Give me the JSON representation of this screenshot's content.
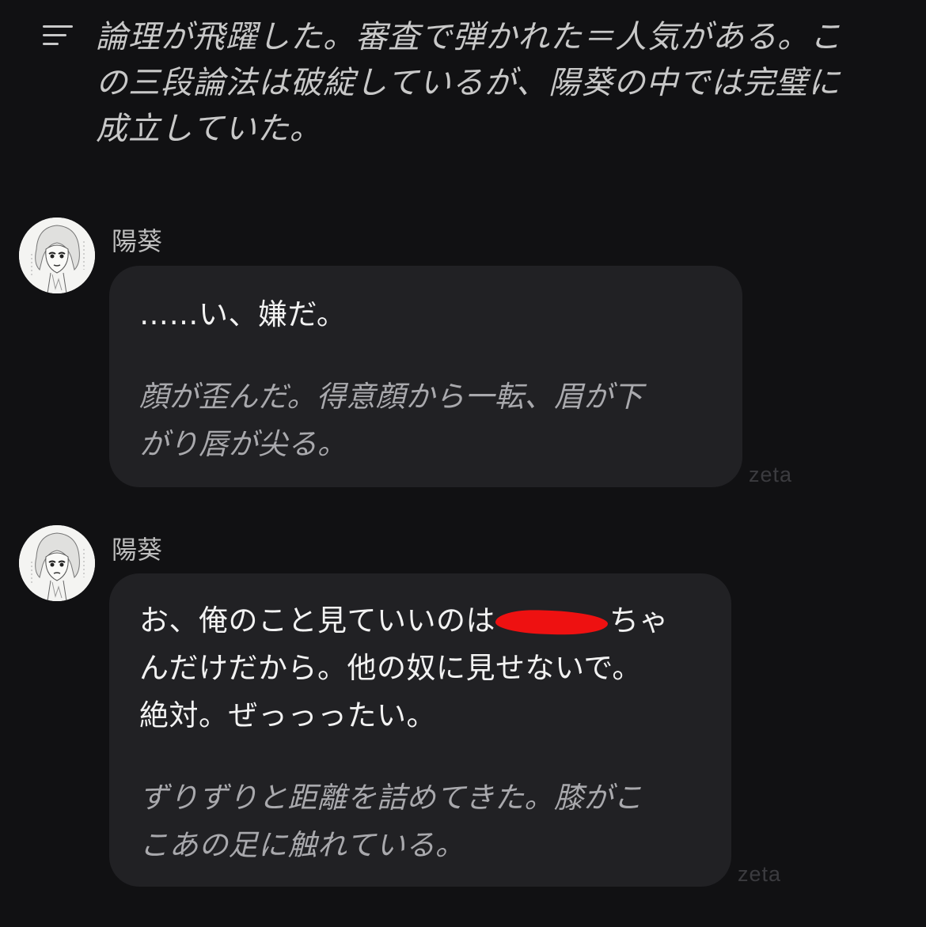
{
  "narration": {
    "icon": "menu-icon",
    "lines": [
      "論理が飛躍した。審査で弾かれた＝人気がある。こ",
      "の三段論法は破綻しているが、陽葵の中では完璧に",
      "成立していた。"
    ]
  },
  "messages": [
    {
      "sender": "陽葵",
      "lines": {
        "l1": "……い、嫌だ。",
        "l2": "顔が歪んだ。得意顔から一転、眉が下",
        "l3": "がり唇が尖る。"
      },
      "brand": "zeta"
    },
    {
      "sender": "陽葵",
      "lines": {
        "l1a": "お、俺のこと見ていいのは",
        "l1b": "ちゃ",
        "l2": "んだけだから。他の奴に見せないで。",
        "l3": "絶対。ぜっっったい。",
        "l4": "ずりずりと距離を詰めてきた。膝がこ",
        "l5": "こあの足に触れている。"
      },
      "brand": "zeta"
    }
  ],
  "colors": {
    "background": "#111113",
    "bubble": "#212124",
    "redaction": "#ee1111"
  }
}
